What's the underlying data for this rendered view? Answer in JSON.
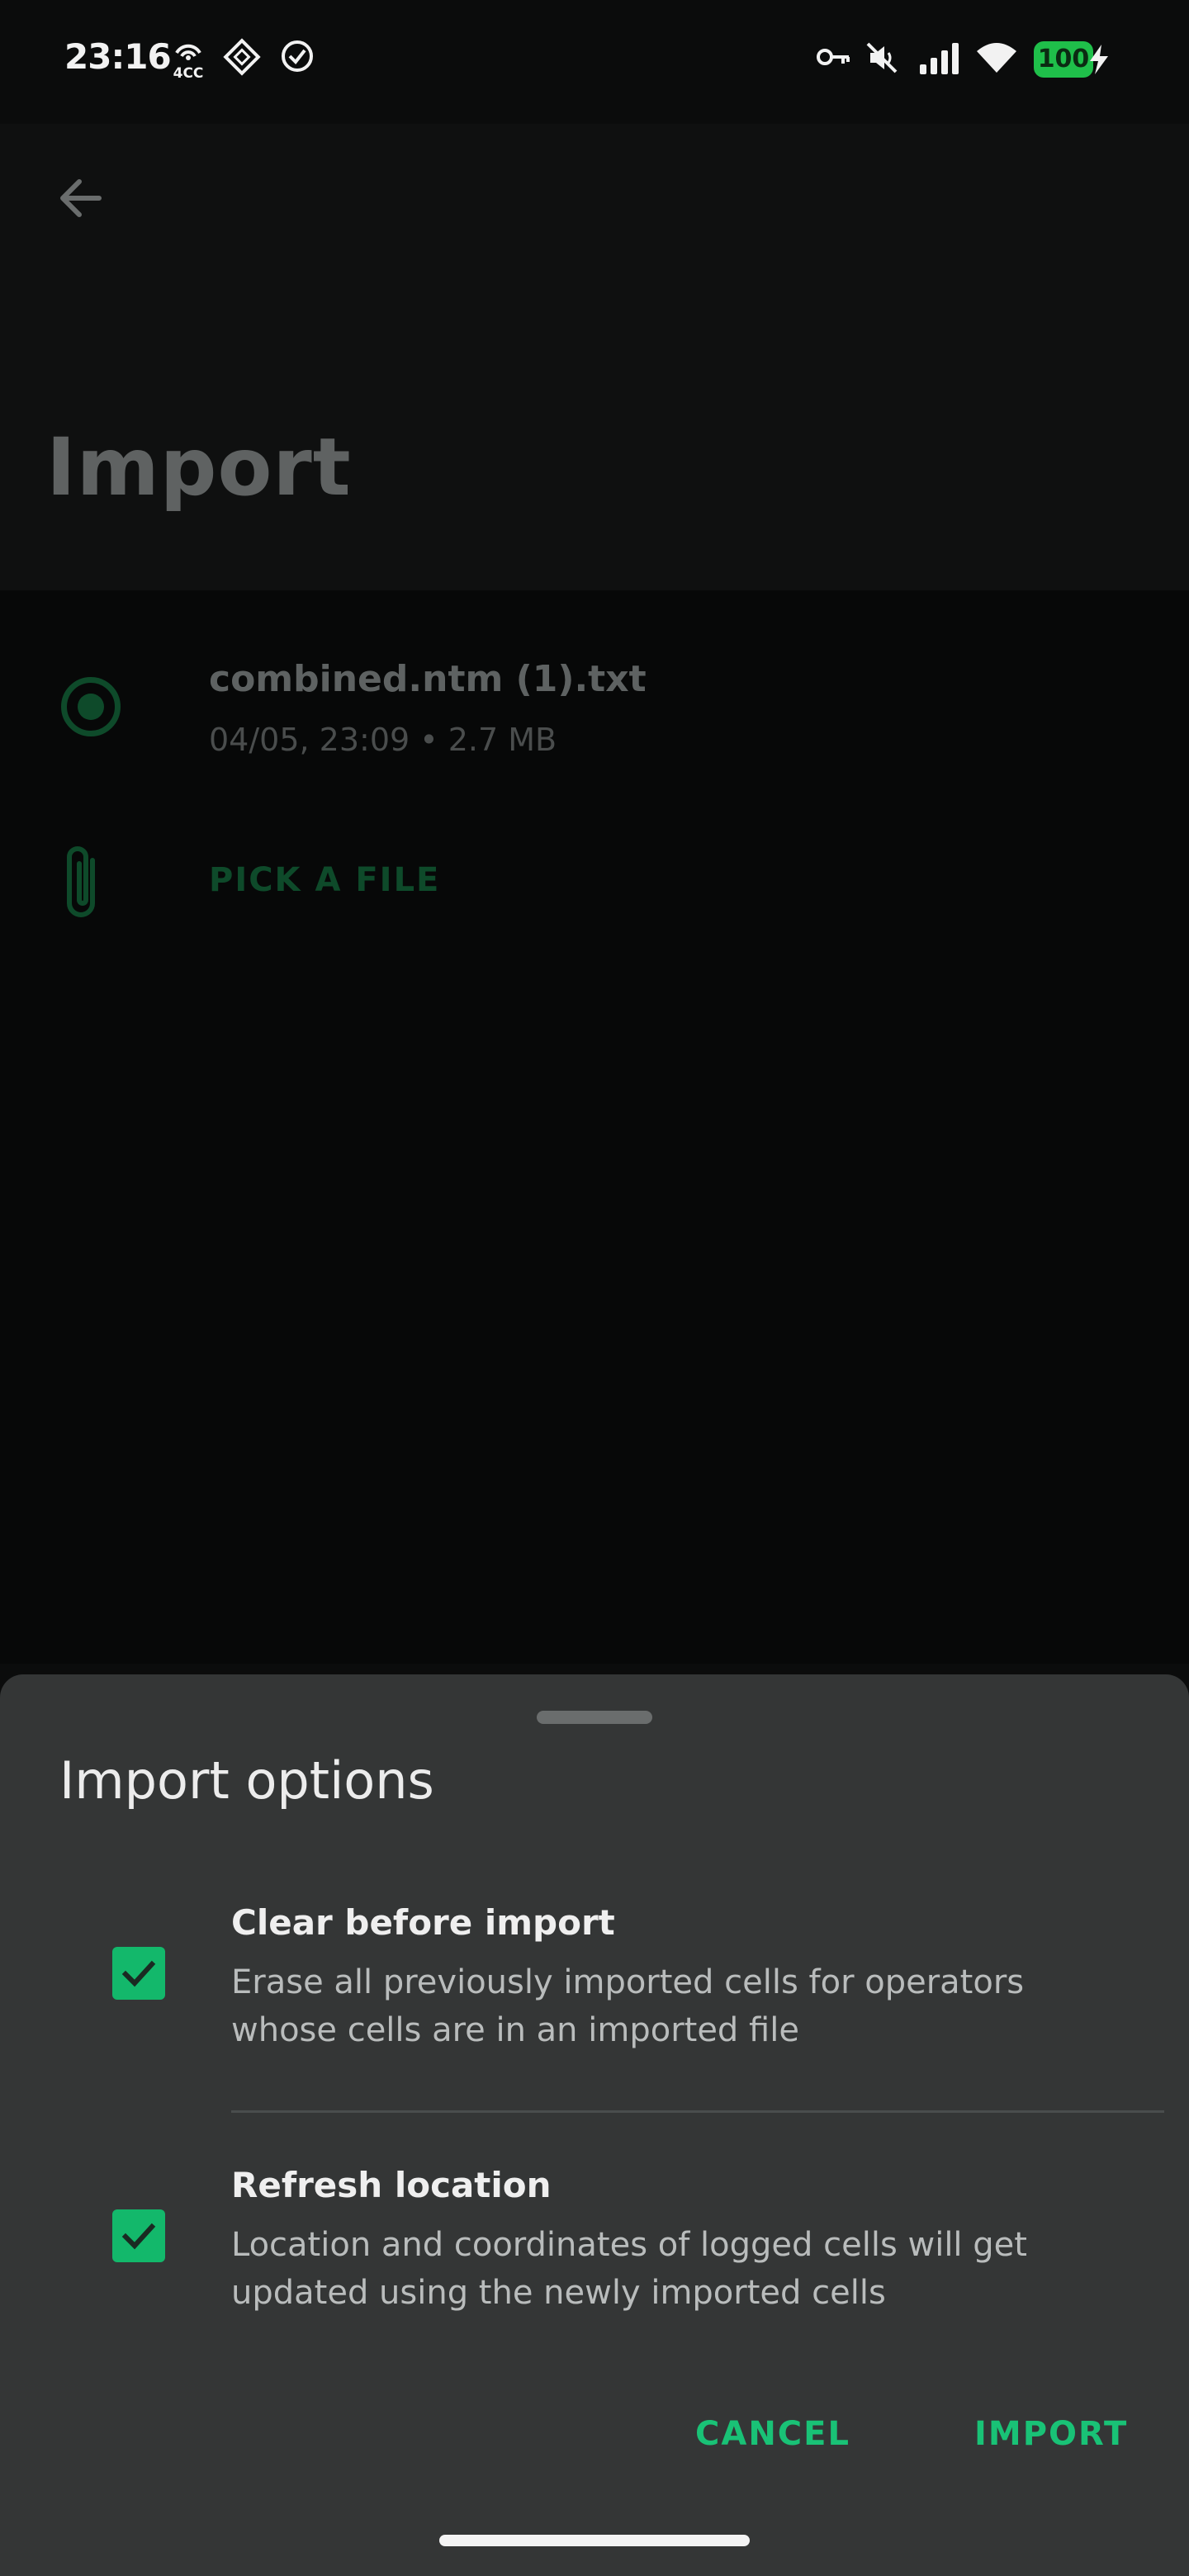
{
  "status_bar": {
    "time": "23:16",
    "notif_icons": [
      "hotspot-4cc-icon",
      "diamond-app-icon",
      "check-circle-icon"
    ],
    "right_icons": [
      "vpn-key-icon",
      "mute-icon",
      "signal-icon",
      "wifi-icon"
    ],
    "battery": "100"
  },
  "header": {
    "title": "Import"
  },
  "file": {
    "name": "combined.ntm (1).txt",
    "meta": "04/05, 23:09 • 2.7 MB"
  },
  "pick_file_label": "PICK A FILE",
  "sheet": {
    "title": "Import options",
    "options": [
      {
        "title": "Clear before import",
        "description": "Erase all previously imported cells for operators whose cells are in an imported file",
        "checked": true
      },
      {
        "title": "Refresh location",
        "description": "Location and coordinates of logged cells will get updated using the newly imported cells",
        "checked": true
      }
    ],
    "cancel_label": "CANCEL",
    "import_label": "IMPORT"
  },
  "colors": {
    "accent": "#19c276",
    "checkbox": "#13b86b",
    "sheet_bg": "#343636"
  }
}
